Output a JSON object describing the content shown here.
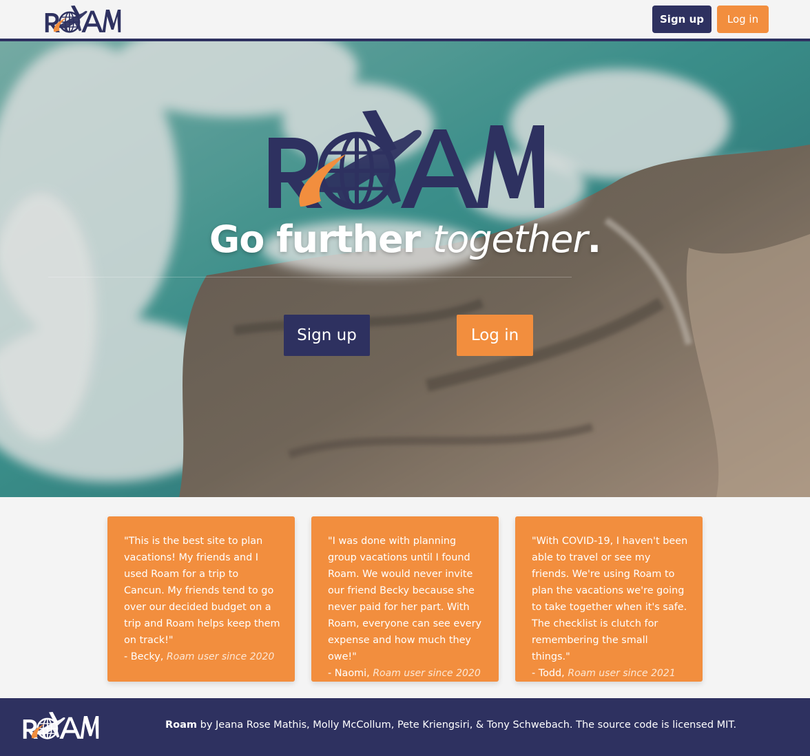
{
  "brand": {
    "name": "ROAM",
    "logo_icon": "globe-airplane-logo"
  },
  "colors": {
    "navy": "#2e3160",
    "orange": "#f28e3e",
    "page_bg": "#f4f4f4"
  },
  "navbar": {
    "signup_label": "Sign up",
    "login_label": "Log in"
  },
  "hero": {
    "tagline_bold": "Go further ",
    "tagline_italic": "together",
    "tagline_end": ".",
    "signup_label": "Sign up",
    "login_label": "Log in",
    "background": "aerial ocean waves over rocky shore"
  },
  "testimonials": [
    {
      "quote": "\"This is the best site to plan vacations! My friends and I used Roam for a trip to Cancun. My friends tend to go over our decided budget on a trip and Roam helps keep them on track!\"",
      "author": "- Becky,",
      "since": "Roam user since 2020"
    },
    {
      "quote": "\"I was done with planning group vacations until I found Roam. We would never invite our friend Becky because she never paid for her part. With Roam, everyone can see every expense and how much they owe!\"",
      "author": "- Naomi,",
      "since": "Roam user since 2020"
    },
    {
      "quote": "\"With COVID-19, I haven't been able to travel or see my friends. We're using Roam to plan the vacations we're going to take together when it's safe. The checklist is clutch for remembering the small things.\"",
      "author": "- Todd,",
      "since": "Roam user since 2021"
    }
  ],
  "footer": {
    "brand": "Roam",
    "credits": " by Jeana Rose Mathis, Molly McCollum, Pete Kriengsiri, & Tony Schwebach. The source code is licensed MIT."
  }
}
